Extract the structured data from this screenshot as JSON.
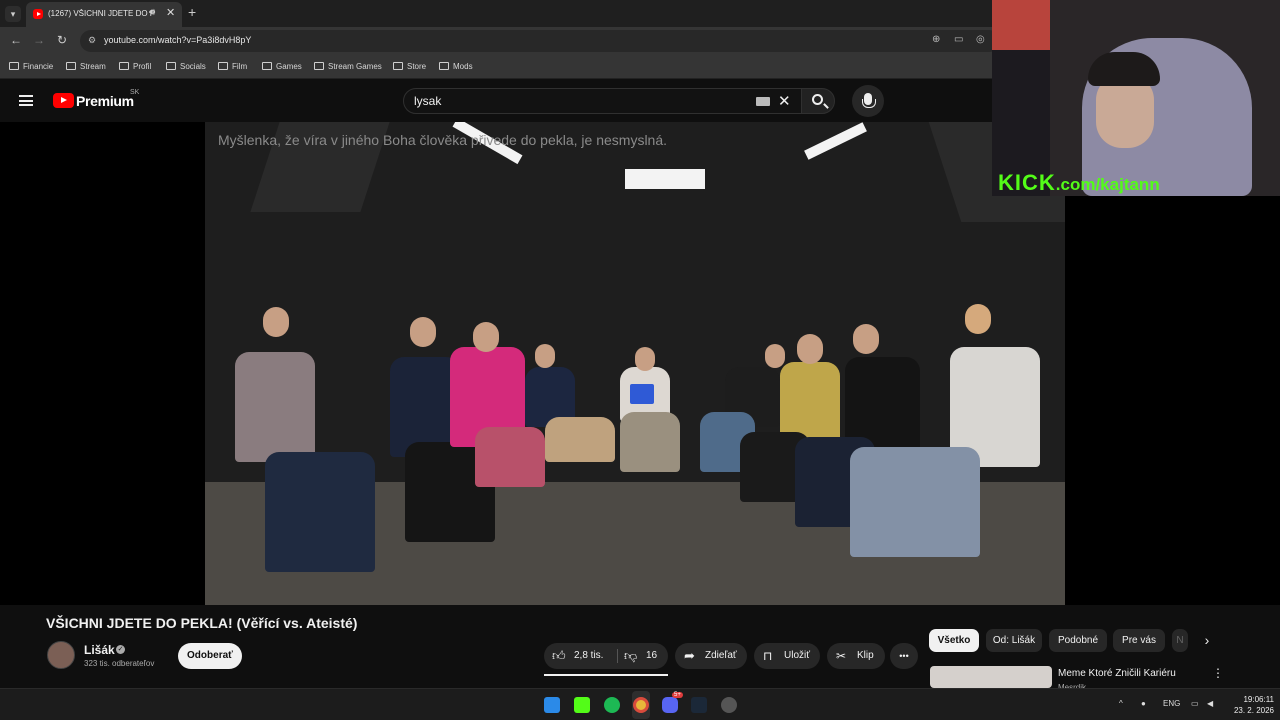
{
  "browser": {
    "tab_title": "(1267) VŠICHNI JDETE DO P",
    "url": "youtube.com/watch?v=Pa3i8dvH8pY",
    "bookmarks": [
      "Financie",
      "Stream",
      "Profil",
      "Socials",
      "Film",
      "Games",
      "Stream Games",
      "Store",
      "Mods"
    ]
  },
  "youtube": {
    "logo_word": "Premium",
    "country_code": "SK",
    "search_value": "lysak"
  },
  "webcam": {
    "overlay_brand": "KICK",
    "overlay_text": ".com/kajtann"
  },
  "video": {
    "caption": "Myšlenka, že víra v jiného Boha člověka přivede do pekla, je nesmyslná.",
    "title": "VŠICHNI JDETE DO PEKLA! (Věřící vs. Ateisté)",
    "channel_name": "Lišák",
    "subscribers": "323 tis. odberateľov",
    "subscribe_label": "Odoberať",
    "likes": "2,8 tis.",
    "dislikes": "16",
    "share_label": "Zdieľať",
    "save_label": "Uložiť",
    "clip_label": "Klip",
    "more_label": "•••"
  },
  "chips": [
    "Všetko",
    "Od: Lišák",
    "Podobné",
    "Pre vás",
    "N"
  ],
  "recommendation": {
    "title": "Meme Ktoré Zničili Kariéru",
    "channel": "Mesrdik"
  },
  "taskbar": {
    "lang": "ENG",
    "time": "19:06:11",
    "date": "23. 2. 2026",
    "discord_badge": "5+"
  },
  "colors": {
    "yt_red": "#ff0000",
    "kick_green": "#53fc18",
    "background": "#0f0f0f"
  }
}
